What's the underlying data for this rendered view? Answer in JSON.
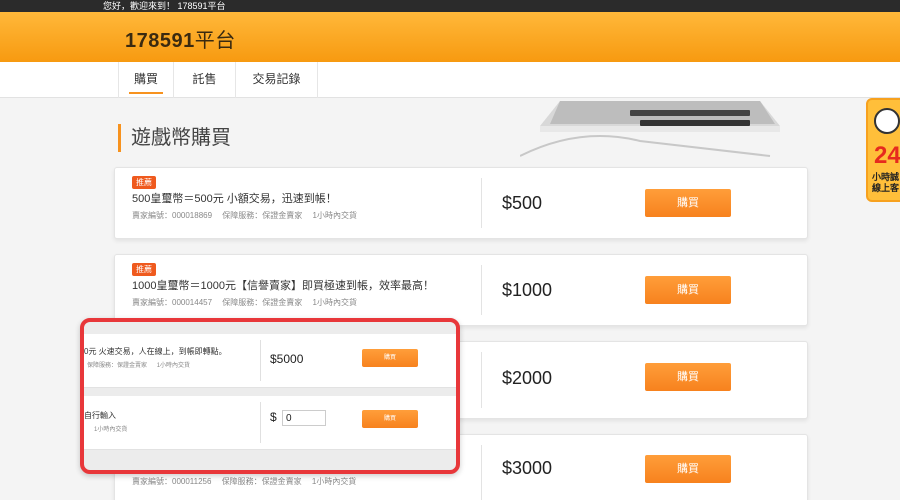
{
  "topbar": {
    "greeting": "您好，歡迎來到！ 178591平台"
  },
  "header": {
    "logo_number": "178591",
    "logo_suffix": "平台"
  },
  "nav": {
    "tabs": [
      {
        "label": "購買"
      },
      {
        "label": "託售"
      },
      {
        "label": "交易記錄"
      }
    ]
  },
  "hero": {
    "title": "遊戲幣購買"
  },
  "side_badge": {
    "big": "24",
    "line1": "小時誠",
    "line2": "線上客"
  },
  "listings": [
    {
      "badge": "推薦",
      "title": "500皇璽幣＝500元 小額交易，迅速到帳！",
      "seller_label": "賣家編號：",
      "seller_id": "000018869",
      "service_label": "保障服務：",
      "service": "保證金賣家",
      "delivery": "1小時內交貨",
      "price": "$500",
      "buy_label": "購買"
    },
    {
      "badge": "推薦",
      "title": "1000皇璽幣＝1000元【信譽賣家】即買極速到帳，效率最高！",
      "seller_label": "賣家編號：",
      "seller_id": "000014457",
      "service_label": "保障服務：",
      "service": "保證金賣家",
      "delivery": "1小時內交貨",
      "price": "$1000",
      "buy_label": "購買"
    },
    {
      "price": "$2000",
      "buy_label": "購買"
    },
    {
      "seller_label": "賣家編號：",
      "seller_id": "000011256",
      "service_label": "保障服務：",
      "service": "保證金賣家",
      "delivery": "1小時內交貨",
      "price": "$3000",
      "buy_label": "購買"
    }
  ],
  "popup": {
    "row1": {
      "title": "0元 火速交易，人在線上，到帳即轉點。",
      "service_label": "保障服務：",
      "service": "保證金賣家",
      "delivery": "1小時內交貨",
      "price": "$5000",
      "buy_label": "購買"
    },
    "row2": {
      "title": "自行輸入",
      "delivery": "1小時內交貨",
      "currency": "$",
      "amount_value": "0",
      "buy_label": "購買"
    }
  }
}
